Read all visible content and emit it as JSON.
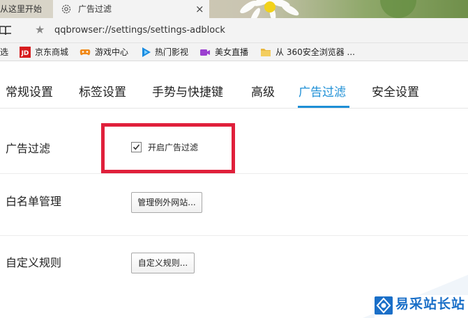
{
  "browser": {
    "inactive_tab_title": "从这里开始",
    "active_tab_title": "广告过滤",
    "close_glyph": "×",
    "url": "qqbrowser://settings/settings-adblock",
    "bookmarks": [
      {
        "label": "选",
        "icon": "none"
      },
      {
        "label": "京东商城",
        "icon": "jd-logo-icon"
      },
      {
        "label": "游戏中心",
        "icon": "gamepad-icon"
      },
      {
        "label": "热门影视",
        "icon": "play-icon"
      },
      {
        "label": "美女直播",
        "icon": "camera-icon"
      },
      {
        "label": "从 360安全浏览器 ...",
        "icon": "folder-icon"
      }
    ],
    "jd_logo_text": "JD"
  },
  "settings": {
    "tabs": [
      {
        "label": "常规设置",
        "active": false
      },
      {
        "label": "标签设置",
        "active": false
      },
      {
        "label": "手势与快捷键",
        "active": false
      },
      {
        "label": "高级",
        "active": false
      },
      {
        "label": "广告过滤",
        "active": true
      },
      {
        "label": "安全设置",
        "active": false
      }
    ],
    "rows": {
      "adblock": {
        "label": "广告过滤",
        "checkbox_label": "开启广告过滤",
        "checked": true
      },
      "whitelist": {
        "label": "白名单管理",
        "button_label": "管理例外网站..."
      },
      "custom_rules": {
        "label": "自定义规则",
        "button_label": "自定义规则..."
      }
    }
  },
  "watermark": {
    "brand": "易采站长站"
  },
  "colors": {
    "accent": "#1d8fd6",
    "highlight": "#e0203b",
    "jd_red": "#d71c1e",
    "game_orange": "#f08a1c",
    "play_blue": "#1a8be0",
    "camera_purple": "#9b3fd0",
    "folder_yellow": "#e8b840",
    "watermark_blue": "#1a6fc8"
  }
}
